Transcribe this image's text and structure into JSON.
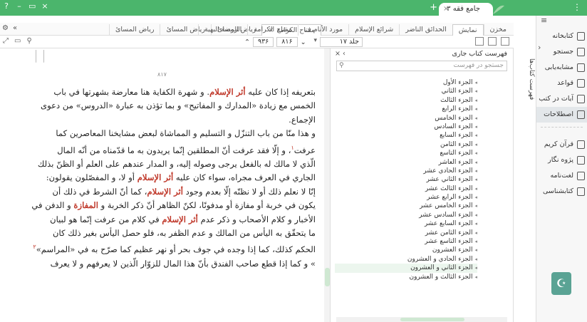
{
  "titlebar": {
    "tab_label": "جامع فقه ۳",
    "plus": "+",
    "dots": "⋮",
    "min": "–",
    "restore": "▭",
    "close": "×",
    "help": "?"
  },
  "sidebar": {
    "chevron": "‹",
    "items": [
      {
        "label": "کتابخانه",
        "active": false
      },
      {
        "label": "جستجو",
        "active": false
      },
      {
        "label": "مشابه‌یابی",
        "active": false
      },
      {
        "label": "قواعد",
        "active": false
      },
      {
        "label": "آیات در کتب",
        "active": false
      },
      {
        "label": "اصطلاحات",
        "active": true
      }
    ],
    "items2": [
      "قرآن کریم",
      "پژوه نگار",
      "لغت‌نامه",
      "کتابشناسی"
    ]
  },
  "catalog_vertical_tab": "فهرست کتاب‌ها",
  "left_tabs": {
    "active": "مفتاح الكرامة",
    "others": [
      "رياض المسائ",
      "رياض المسائ",
      "رياض المسائ"
    ]
  },
  "middle_tabs": [
    "مخزن",
    "نمایش",
    "الحدائق الناضر",
    "شرائع الإسلام",
    "مورد الأنام ف",
    "مفتاح الكرامة",
    "الروضة البهية"
  ],
  "toolbar": {
    "page": "۹۳۶",
    "total": "۸۱۶",
    "volume": "جلد ۱۷"
  },
  "page_number": "۸۱۷",
  "text_lines": [
    {
      "pre": "بتعريفه إذا كان عليه ",
      "hl": "أثر الإسلام",
      "post": ". و شهرة الكفاية هنا معارضة بشهرتها في باب"
    },
    {
      "pre": "الخمس مع زيادة «المدارك و المفاتيح» و بما تؤذن به عبارة «الدروس» من دعوى",
      "hl": "",
      "post": ""
    },
    {
      "pre": "الإجماع.",
      "hl": "",
      "post": ""
    },
    {
      "pre": "و هذا منّا من باب التنزّل و التسليم و المماشاة لبعض مشايخنا المعاصرين كما",
      "hl": "",
      "post": ""
    },
    {
      "pre": "عرفت",
      "fn": "١",
      "hl": "",
      "post": "، و إلّا فقد عرفت أنّ المطلقين إنّما يريدون به ما قدّمناه من أنّه المال"
    },
    {
      "pre": "الّذي لا مالك له بالفعل يرجى وصوله إليه، و المدار عندهم على العلم أو الظنّ بذلك",
      "hl": "",
      "post": ""
    },
    {
      "pre": "الجاري في العرف مجراه، سواء كان عليه ",
      "hl": "أثر الإسلام",
      "post": " أو لا، و المفصّلون يقولون:"
    },
    {
      "pre": "إنّا لا نعلم ذلك أو لا نظنّه إلّا بعدم وجود ",
      "hl": "أثر الإسلام",
      "post": "، كما أنّ الشرط في ذلك أن"
    },
    {
      "pre": "يكون في خربة أو مفازة أو مدفونًا، لكنّ الظاهر أنّ ذكر الخربة و ",
      "hl": "المفازة",
      "post": " و الدفن في"
    },
    {
      "pre": "الأخبار و كلام الأصحاب و ذكر عدم ",
      "hl": "أثر الإسلام",
      "post": " في كلام من عرفت إنّما هو لبيان"
    },
    {
      "pre": "ما يتحقّق به اليأس من المالك و عدم الظفر به، فلو حصل اليأس بغير ذلك كان",
      "hl": "",
      "post": ""
    },
    {
      "pre": "الحكم كذلك، كما إذا وجده في جوف بحر أو نهر عظيم كما صرّح به في «المراسم»",
      "fn": "٢",
      "hl": "",
      "post": ""
    },
    {
      "pre": "» و كما إذا قطع صاحب الفندق بأنّ هذا المال للزوّار الّذين لا يعرفهم و لا يعرف",
      "hl": "",
      "post": ""
    }
  ],
  "catalog": {
    "title": "فهرست کتاب جاری",
    "search_placeholder": "جستجو در فهرست",
    "items": [
      "الجزء الأول",
      "الجزء الثاني",
      "الجزء الثالث",
      "الجزء الرابع",
      "الجزء الخامس",
      "الجزء السادس",
      "الجزء السابع",
      "الجزء الثامن",
      "الجزء التاسع",
      "الجزء العاشر",
      "الجزء الحادي عشر",
      "الجزء الثاني عشر",
      "الجزء الثالث عشر",
      "الجزء الرابع عشر",
      "الجزء الخامس عشر",
      "الجزء السادس عشر",
      "الجزء السابع عشر",
      "الجزء الثامن عشر",
      "الجزء التاسع عشر",
      "الجزء العشرون",
      "الجزء الحادي و العشرون",
      "الجزء الثاني و العشرون",
      "الجزء الثالث و العشرون"
    ],
    "active_index": 21
  }
}
